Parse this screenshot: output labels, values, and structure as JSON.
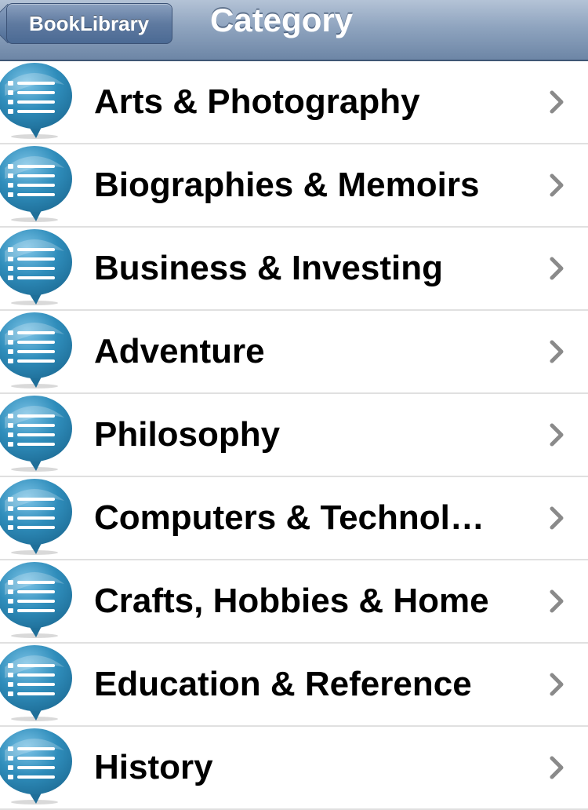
{
  "navbar": {
    "back_label": "BookLibrary",
    "title": "Category"
  },
  "colors": {
    "navbar": "#8fa4bf",
    "icon_blue": "#2f8dbb",
    "chevron": "#8a8a8a"
  },
  "categories": [
    {
      "label": "Arts & Photography",
      "icon": "list-bubble-icon"
    },
    {
      "label": "Biographies & Memoirs",
      "icon": "list-bubble-icon"
    },
    {
      "label": "Business & Investing",
      "icon": "list-bubble-icon"
    },
    {
      "label": "Adventure",
      "icon": "list-bubble-icon"
    },
    {
      "label": "Philosophy",
      "icon": "list-bubble-icon"
    },
    {
      "label": "Computers & Technol…",
      "icon": "list-bubble-icon"
    },
    {
      "label": "Crafts, Hobbies & Home",
      "icon": "list-bubble-icon"
    },
    {
      "label": "Education & Reference",
      "icon": "list-bubble-icon"
    },
    {
      "label": "History",
      "icon": "list-bubble-icon"
    }
  ]
}
